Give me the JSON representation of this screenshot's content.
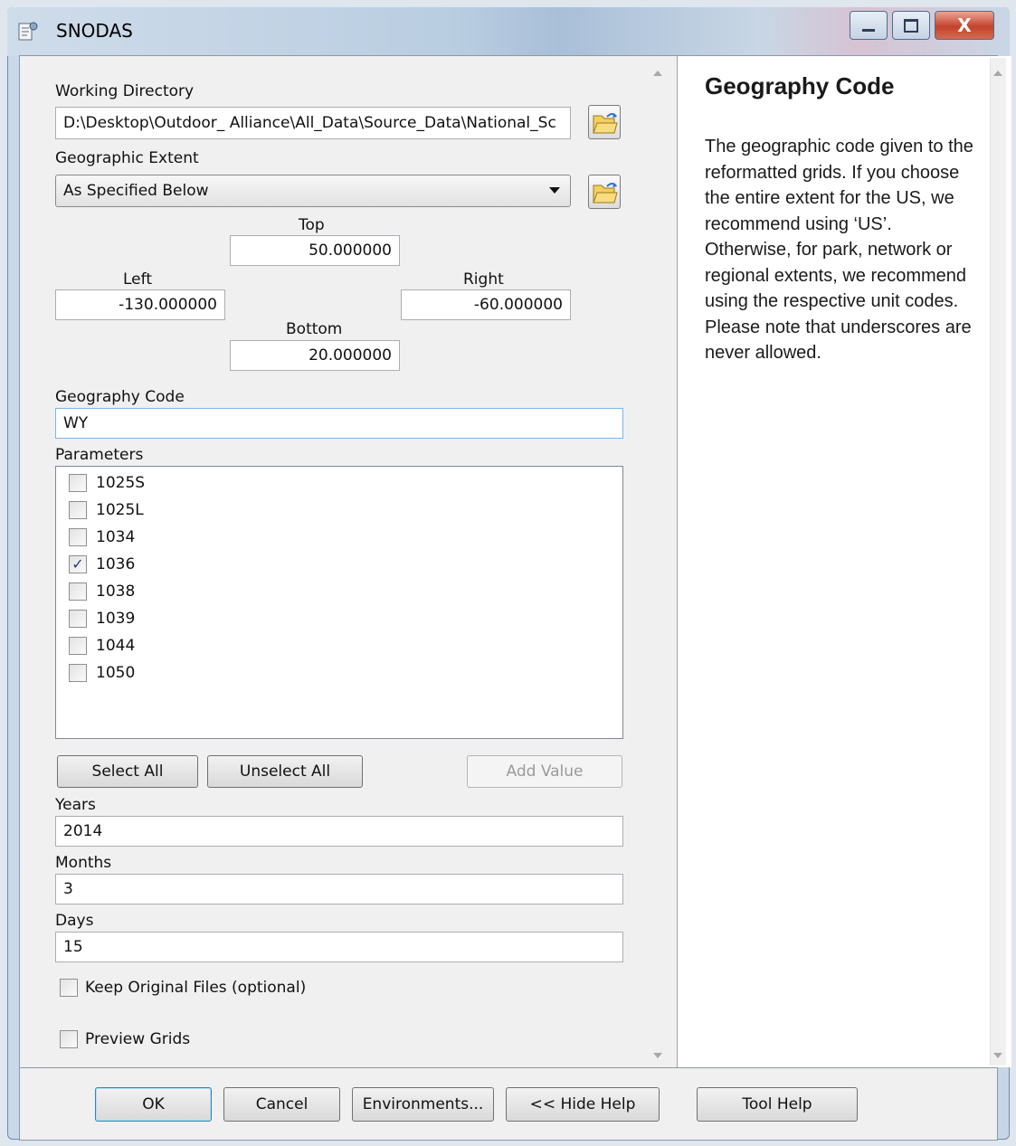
{
  "window": {
    "title": "SNODAS",
    "close_glyph": "X",
    "icons": [
      "tool-icon",
      "minimize-icon",
      "maximize-icon",
      "close-icon"
    ]
  },
  "form": {
    "working_directory": {
      "label": "Working Directory",
      "value": "D:\\Desktop\\Outdoor_ Alliance\\All_Data\\Source_Data\\National_Sc"
    },
    "geographic_extent": {
      "label": "Geographic Extent",
      "selected": "As Specified Below",
      "top_label": "Top",
      "top": "50.000000",
      "left_label": "Left",
      "left": "-130.000000",
      "right_label": "Right",
      "right": "-60.000000",
      "bottom_label": "Bottom",
      "bottom": "20.000000"
    },
    "geography_code": {
      "label": "Geography Code",
      "value": "WY"
    },
    "parameters": {
      "label": "Parameters",
      "items": [
        {
          "label": "1025S",
          "checked": false
        },
        {
          "label": "1025L",
          "checked": false
        },
        {
          "label": "1034",
          "checked": false
        },
        {
          "label": "1036",
          "checked": true
        },
        {
          "label": "1038",
          "checked": false
        },
        {
          "label": "1039",
          "checked": false
        },
        {
          "label": "1044",
          "checked": false
        },
        {
          "label": "1050",
          "checked": false
        }
      ],
      "select_all": "Select All",
      "unselect_all": "Unselect All",
      "add_value": "Add Value"
    },
    "years": {
      "label": "Years",
      "value": "2014"
    },
    "months": {
      "label": "Months",
      "value": "3"
    },
    "days": {
      "label": "Days",
      "value": "15"
    },
    "keep_original": {
      "label": "Keep Original Files (optional)",
      "checked": false
    },
    "preview_grids": {
      "label": "Preview Grids",
      "checked": false
    }
  },
  "help": {
    "title": "Geography Code",
    "body": "The geographic code given to the reformatted grids. If you choose the entire extent for the US, we recommend using ‘US’. Otherwise, for park, network or regional extents, we recommend using the respective unit codes. Please note that underscores are never allowed."
  },
  "buttons": {
    "ok": "OK",
    "cancel": "Cancel",
    "environments": "Environments...",
    "hide_help": "<< Hide Help",
    "tool_help": "Tool Help"
  },
  "colors": {
    "focus_border": "#7eb4ea",
    "check_mark": "#203f7a",
    "close_button": "#c4422b"
  }
}
